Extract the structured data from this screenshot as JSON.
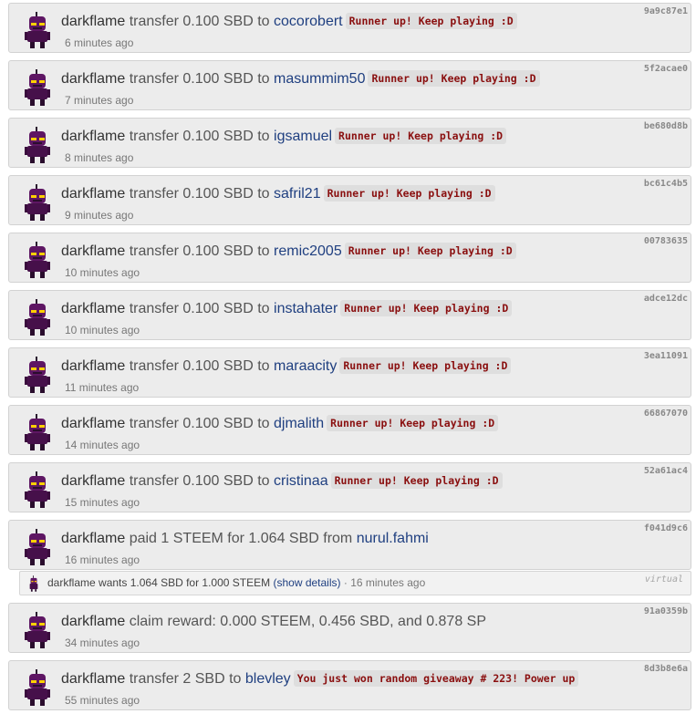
{
  "rows": [
    {
      "user": "darkflame",
      "verb": "transfer 0.100 SBD to",
      "target": "cocorobert",
      "memo": "Runner up! Keep playing :D",
      "time": "6 minutes ago",
      "hash": "9a9c87e1"
    },
    {
      "user": "darkflame",
      "verb": "transfer 0.100 SBD to",
      "target": "masummim50",
      "memo": "Runner up! Keep playing :D",
      "time": "7 minutes ago",
      "hash": "5f2acae0"
    },
    {
      "user": "darkflame",
      "verb": "transfer 0.100 SBD to",
      "target": "igsamuel",
      "memo": "Runner up! Keep playing :D",
      "time": "8 minutes ago",
      "hash": "be680d8b"
    },
    {
      "user": "darkflame",
      "verb": "transfer 0.100 SBD to",
      "target": "safril21",
      "memo": "Runner up! Keep playing :D",
      "time": "9 minutes ago",
      "hash": "bc61c4b5"
    },
    {
      "user": "darkflame",
      "verb": "transfer 0.100 SBD to",
      "target": "remic2005",
      "memo": "Runner up! Keep playing :D",
      "time": "10 minutes ago",
      "hash": "00783635"
    },
    {
      "user": "darkflame",
      "verb": "transfer 0.100 SBD to",
      "target": "instahater",
      "memo": "Runner up! Keep playing :D",
      "time": "10 minutes ago",
      "hash": "adce12dc"
    },
    {
      "user": "darkflame",
      "verb": "transfer 0.100 SBD to",
      "target": "maraacity",
      "memo": "Runner up! Keep playing :D",
      "time": "11 minutes ago",
      "hash": "3ea11091"
    },
    {
      "user": "darkflame",
      "verb": "transfer 0.100 SBD to",
      "target": "djmalith",
      "memo": "Runner up! Keep playing :D",
      "time": "14 minutes ago",
      "hash": "66867070"
    },
    {
      "user": "darkflame",
      "verb": "transfer 0.100 SBD to",
      "target": "cristinaa",
      "memo": "Runner up! Keep playing :D",
      "time": "15 minutes ago",
      "hash": "52a61ac4"
    },
    {
      "user": "darkflame",
      "verb": "paid 1 STEEM for 1.064 SBD from",
      "target": "nurul.fahmi",
      "memo": "",
      "time": "16 minutes ago",
      "hash": "f041d9c6"
    },
    {
      "user": "darkflame",
      "verb": "claim reward: 0.000 STEEM, 0.456 SBD, and 0.878 SP",
      "target": "",
      "memo": "",
      "time": "34 minutes ago",
      "hash": "91a0359b"
    },
    {
      "user": "darkflame",
      "verb": "transfer 2 SBD to",
      "target": "blevley",
      "memo": "You just won random giveaway # 223! Power up",
      "time": "55 minutes ago",
      "hash": "8d3b8e6a"
    }
  ],
  "order": {
    "user": "darkflame",
    "text": "wants 1.064 SBD for 1.000 STEEM",
    "details": "(show details)",
    "separator": "·",
    "time": "16 minutes ago",
    "tag": "virtual"
  }
}
